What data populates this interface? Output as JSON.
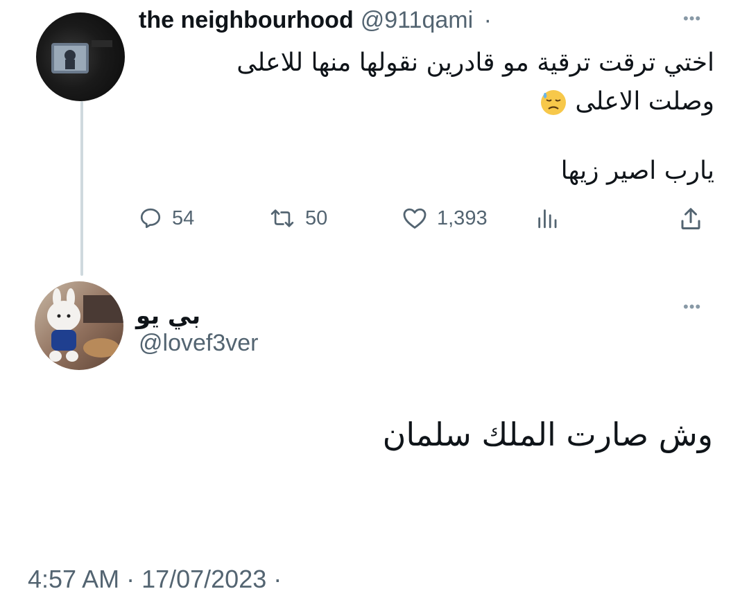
{
  "original_tweet": {
    "author_name": "the neighbourhood",
    "author_handle": "@911qami",
    "separator": "·",
    "more_icon": "more-horizontal-icon",
    "avatar_icon": "avatar",
    "text_line_1": "اختي ترقت ترقية مو قادرين نقولها منها للاعلى",
    "text_line_2": "وصلت الاعلى",
    "text_line_3": "يارب اصير زيها",
    "emoji": "sad-sweat-emoji",
    "actions": {
      "reply_count": "54",
      "retweet_count": "50",
      "like_count": "1,393",
      "reply_icon": "reply-icon",
      "retweet_icon": "retweet-icon",
      "like_icon": "heart-icon",
      "views_icon": "views-chart-icon",
      "share_icon": "share-icon"
    }
  },
  "reply_tweet": {
    "author_name": "بي يو",
    "author_handle": "@lovef3ver",
    "more_icon": "more-horizontal-icon",
    "text": "وش صارت الملك سلمان",
    "timestamp": "4:57 AM · 17/07/2023 ·"
  },
  "colors": {
    "primary_text": "#0f1419",
    "secondary_text": "#536471",
    "thread_line": "#cfd9de",
    "emoji_yellow": "#f7c84a"
  }
}
